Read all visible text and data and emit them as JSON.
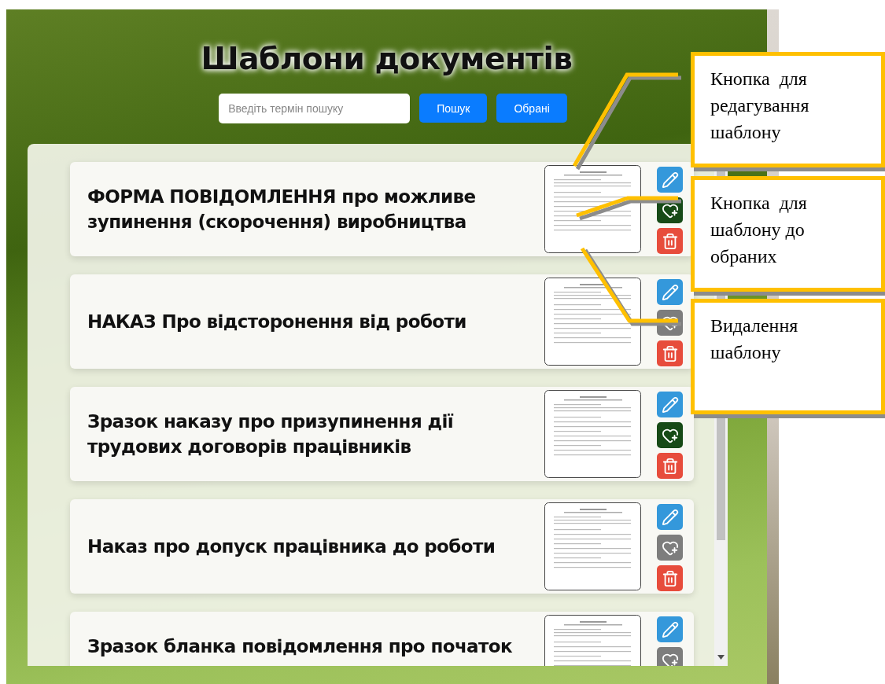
{
  "title": "Шаблони документів",
  "search": {
    "placeholder": "Введіть термін пошуку"
  },
  "buttons": [
    {
      "label": "Пошук"
    },
    {
      "label": "Обрані"
    }
  ],
  "templates": [
    {
      "title": "ФОРМА ПОВІДОМЛЕННЯ про можливе зупинення (скорочення) виробництва",
      "favorite": true
    },
    {
      "title": "НАКАЗ Про відсторонення від роботи",
      "favorite": false
    },
    {
      "title": "Зразок наказу про призупинення дії трудових договорів працівників",
      "favorite": true
    },
    {
      "title": "Наказ про допуск працівника до роботи",
      "favorite": false
    },
    {
      "title": "Зразок бланка повідомлення про початок",
      "favorite": false
    }
  ],
  "callouts": [
    {
      "text": "Кнопка  для редагування шаблону"
    },
    {
      "text": "Кнопка  для шаблону до обраних"
    },
    {
      "text": "Видалення шаблону"
    }
  ]
}
